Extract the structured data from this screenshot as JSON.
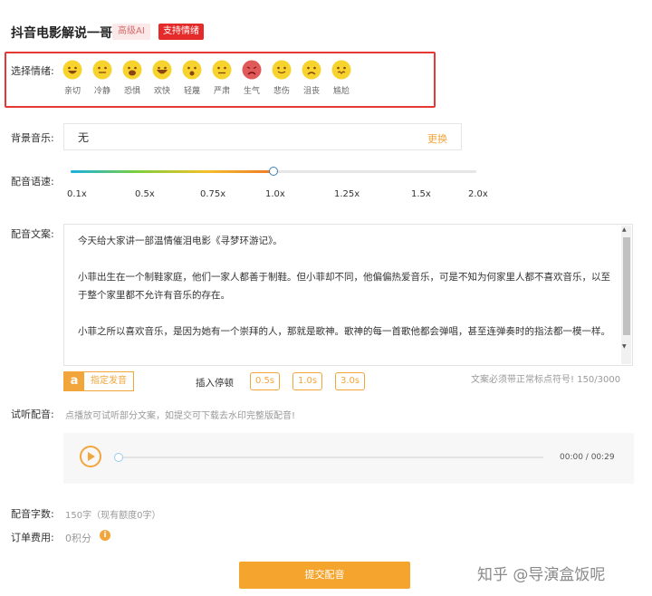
{
  "header": {
    "title": "抖音电影解说一哥",
    "badge_ai": "高级AI",
    "badge_emotion": "支持情绪"
  },
  "emotion": {
    "label": "选择情绪:",
    "items": [
      {
        "name": "亲切",
        "icon": "grin-face-icon"
      },
      {
        "name": "冷静",
        "icon": "neutral-face-icon"
      },
      {
        "name": "恐惧",
        "icon": "fearful-face-icon"
      },
      {
        "name": "欢快",
        "icon": "laughing-face-icon"
      },
      {
        "name": "轻蔑",
        "icon": "surprised-face-icon"
      },
      {
        "name": "严肃",
        "icon": "serious-face-icon"
      },
      {
        "name": "生气",
        "icon": "angry-face-icon"
      },
      {
        "name": "悲伤",
        "icon": "sad-face-icon"
      },
      {
        "name": "沮丧",
        "icon": "frown-face-icon"
      },
      {
        "name": "尴尬",
        "icon": "awkward-face-icon"
      }
    ],
    "selected": "生气"
  },
  "music": {
    "label": "背景音乐:",
    "value": "无",
    "change": "更换"
  },
  "speed": {
    "label": "配音语速:",
    "ticks": [
      "0.1x",
      "0.5x",
      "0.75x",
      "1.0x",
      "1.25x",
      "1.5x",
      "2.0x"
    ],
    "value": "1.0x"
  },
  "script": {
    "label": "配音文案:",
    "paragraphs": [
      "今天给大家讲一部温情催泪电影《寻梦环游记》。",
      "小菲出生在一个制鞋家庭，他们一家人都善于制鞋。但小菲却不同，他偏偏热爱音乐，可是不知为何家里人都不喜欢音乐，以至于整个家里都不允许有音乐的存在。",
      "小菲之所以喜欢音乐，是因为她有一个崇拜的人，那就是歌神。歌神的每一首歌他都会弹唱，甚至连弹奏时的指法都一模一样。"
    ],
    "specify_btn": "指定发音",
    "specify_icon": "a",
    "insert_pause": "插入停顿",
    "pauses": [
      "0.5s",
      "1.0s",
      "3.0s"
    ],
    "hint": "文案必须带正常标点符号!",
    "count": "150/3000"
  },
  "preview": {
    "label": "试听配音:",
    "hint": "点播放可试听部分文案，如提交可下载去水印完整版配音!",
    "time": "00:00 / 00:29",
    "progress": 0
  },
  "summary": {
    "chars_label": "配音字数:",
    "chars_value": "150字（现有额度0字）",
    "fee_label": "订单费用:",
    "fee_value": "0积分",
    "info_icon": "i"
  },
  "submit": "提交配音",
  "watermark": "知乎 @导演盒饭呢",
  "colors": {
    "accent": "#f5a52e",
    "highlight_border": "#e53935",
    "badge_red": "#e52a2a"
  }
}
